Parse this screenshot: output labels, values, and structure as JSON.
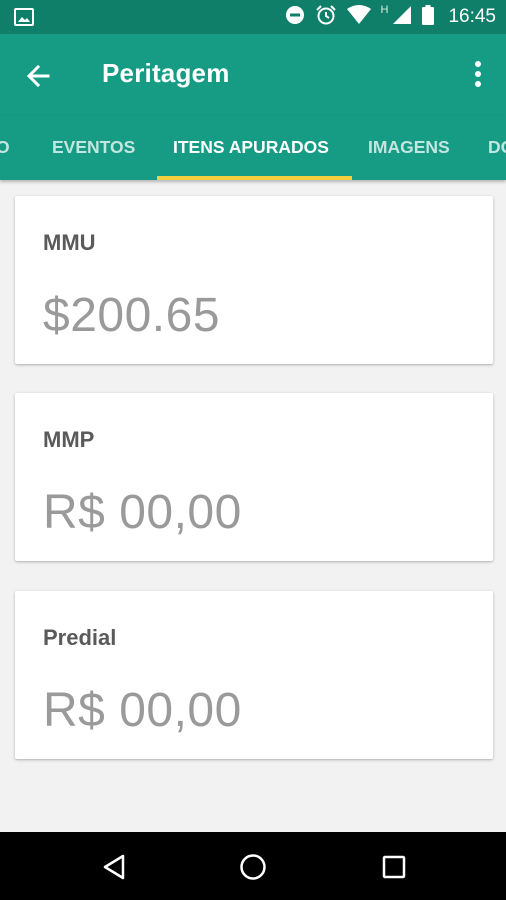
{
  "status_bar": {
    "time": "16:45",
    "network_letter": "H",
    "icons": [
      "image-icon",
      "do-not-disturb-icon",
      "alarm-icon",
      "wifi-icon",
      "cell-signal-icon",
      "battery-icon"
    ]
  },
  "app_bar": {
    "title": "Peritagem",
    "back_icon": "arrow-back-icon",
    "menu_icon": "more-vert-icon"
  },
  "tabs": [
    {
      "label": "O",
      "active": false
    },
    {
      "label": "EVENTOS",
      "active": false
    },
    {
      "label": "ITENS APURADOS",
      "active": true
    },
    {
      "label": "IMAGENS",
      "active": false
    },
    {
      "label": "DO",
      "active": false
    }
  ],
  "cards": [
    {
      "label": "MMU",
      "value": "$200.65"
    },
    {
      "label": "MMP",
      "value": "R$ 00,00"
    },
    {
      "label": "Predial",
      "value": "R$ 00,00"
    }
  ],
  "colors": {
    "status_bar": "#0f7f6a",
    "primary": "#169b85",
    "tab_indicator": "#f4d03f",
    "background": "#f2f2f2",
    "label_text": "#5a5a5a",
    "value_text": "#9a9a9a"
  },
  "nav_bar": {
    "icons": [
      "back-triangle-icon",
      "home-circle-icon",
      "recents-square-icon"
    ]
  }
}
